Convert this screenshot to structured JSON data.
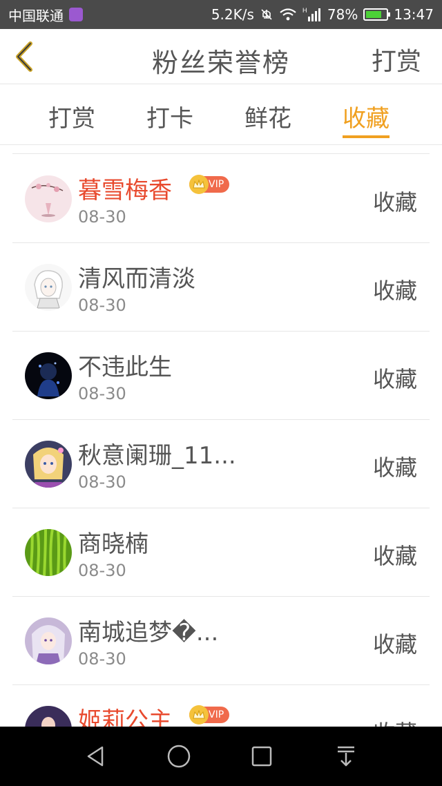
{
  "status_bar": {
    "carrier": "中国联通",
    "speed": "5.2K/s",
    "signal_label": "H",
    "battery": "78%",
    "time": "13:47"
  },
  "header": {
    "title": "粉丝荣誉榜",
    "action": "打赏"
  },
  "tabs": [
    {
      "label": "打赏",
      "active": false
    },
    {
      "label": "打卡",
      "active": false
    },
    {
      "label": "鲜花",
      "active": false
    },
    {
      "label": "收藏",
      "active": true
    }
  ],
  "list": {
    "items": [
      {
        "name": "暮雪梅香",
        "date": "08-30",
        "vip": true,
        "vip_label": "VIP",
        "action": "收藏",
        "avatar": "pink-blossom"
      },
      {
        "name": "清风而清淡",
        "date": "08-30",
        "vip": false,
        "action": "收藏",
        "avatar": "white-hair-character"
      },
      {
        "name": "不违此生",
        "date": "08-30",
        "vip": false,
        "action": "收藏",
        "avatar": "dark-blue-character"
      },
      {
        "name": "秋意阑珊_11...",
        "date": "08-30",
        "vip": false,
        "action": "收藏",
        "avatar": "colorful-anime-girl"
      },
      {
        "name": "商晓楠",
        "date": "08-30",
        "vip": false,
        "action": "收藏",
        "avatar": "green-grass"
      },
      {
        "name": "南城追梦�...",
        "date": "08-30",
        "vip": false,
        "action": "收藏",
        "avatar": "purple-anime-girl"
      },
      {
        "name": "姬莉公主",
        "date": "",
        "vip": true,
        "vip_label": "VIP",
        "action": "收藏",
        "avatar": "dark-girl"
      }
    ]
  },
  "colors": {
    "accent": "#f0a020",
    "vip_name": "#e84a2e",
    "status_bar": "#4a4a4a"
  }
}
